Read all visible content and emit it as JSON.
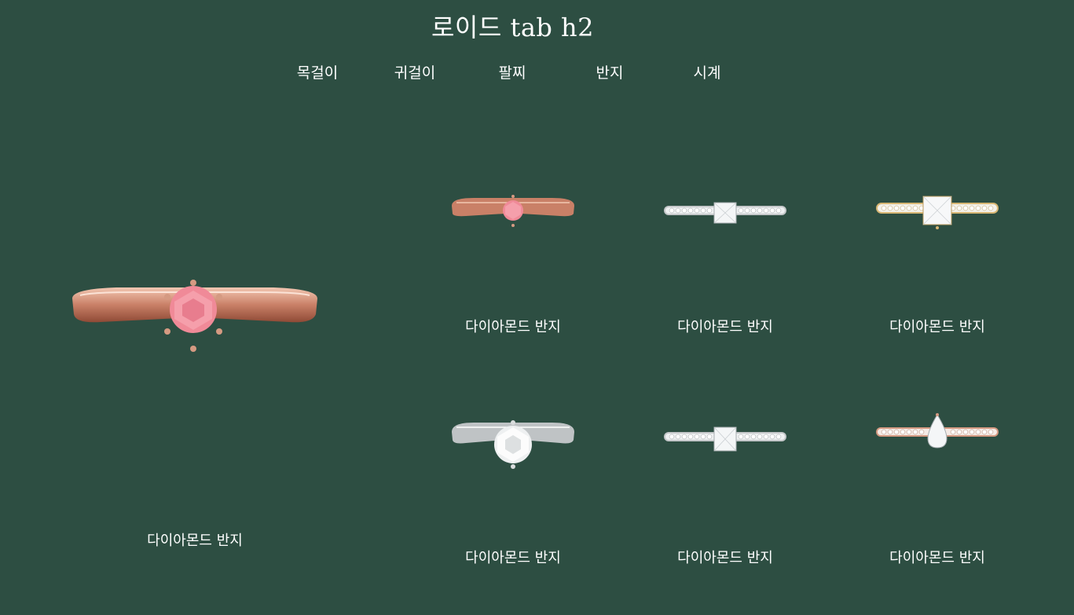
{
  "page": {
    "title": "로이드 tab h2"
  },
  "tabs": [
    {
      "label": "목걸이"
    },
    {
      "label": "귀걸이"
    },
    {
      "label": "팔찌"
    },
    {
      "label": "반지"
    },
    {
      "label": "시계"
    }
  ],
  "featured": {
    "caption": "다이아몬드 반지",
    "icon": "rose-gold-pink-solitaire-ring-icon"
  },
  "products": [
    {
      "caption": "다이아몬드 반지",
      "icon": "rose-gold-pink-solitaire-ring-icon"
    },
    {
      "caption": "다이아몬드 반지",
      "icon": "white-gold-princess-pave-ring-icon"
    },
    {
      "caption": "다이아몬드 반지",
      "icon": "yellow-gold-princess-pave-ring-icon"
    },
    {
      "caption": "다이아몬드 반지",
      "icon": "white-gold-solitaire-ring-icon"
    },
    {
      "caption": "다이아몬드 반지",
      "icon": "white-gold-princess-pave-ring-icon"
    },
    {
      "caption": "다이아몬드 반지",
      "icon": "rose-gold-pear-pave-ring-icon"
    }
  ],
  "colors": {
    "background": "#2d4e42",
    "text": "#ffffff",
    "rose_gold": "#d59a82",
    "white_gold": "#d9dcdd",
    "yellow_gold": "#e3c78a",
    "pink_diamond": "#f08a98",
    "white_diamond": "#f4f6f7"
  }
}
